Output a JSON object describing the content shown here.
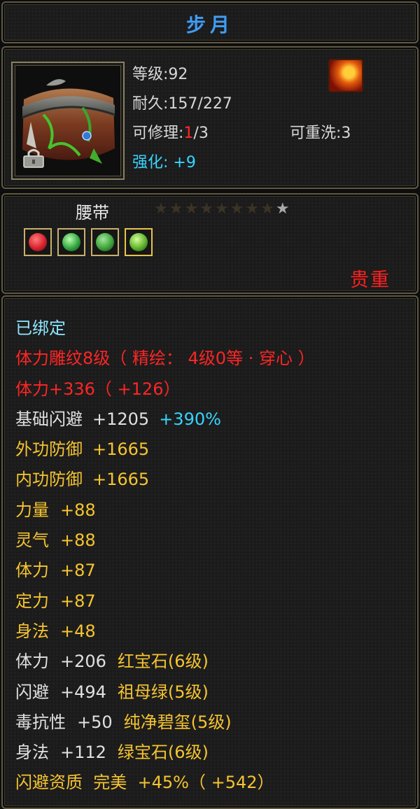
{
  "item": {
    "name": "步月",
    "level": "等级:92",
    "durability": "耐久:157/227",
    "repair_prefix": "可修理:",
    "repair_used": "1",
    "repair_total": "/3",
    "rewash": "可重洗:3",
    "strength_label": "强化:",
    "strength_value": "+9",
    "type": "腰带",
    "stars_total": 9,
    "stars_lit": 1,
    "rarity": "贵重"
  },
  "gems": [
    {
      "icon": "ruby-gem-icon",
      "color": "#d8222d"
    },
    {
      "icon": "emerald-gem-icon",
      "color": "#34a640"
    },
    {
      "icon": "jade-gem-icon",
      "color": "#3fa23a"
    },
    {
      "icon": "green-gem-icon",
      "color": "#5fb22d"
    }
  ],
  "attributes": {
    "bound": "已绑定",
    "engrave": "体力雕纹8级（ 精绘： 4级0等 · 穿心 ）",
    "stamina_main": "体力+336（ +126）",
    "dodge_base": {
      "label": "基础闪避",
      "value": "+1205",
      "extra": "+390%"
    },
    "outer_defense": {
      "label": "外功防御",
      "value": "+1665"
    },
    "inner_defense": {
      "label": "内功防御",
      "value": "+1665"
    },
    "power": {
      "label": "力量",
      "value": "+88"
    },
    "spirit": {
      "label": "灵气",
      "value": "+88"
    },
    "stamina": {
      "label": "体力",
      "value": "+87"
    },
    "focus": {
      "label": "定力",
      "value": "+87"
    },
    "agility": {
      "label": "身法",
      "value": "+48"
    },
    "gem_stamina": {
      "label": "体力",
      "value": "+206",
      "gem": "红宝石",
      "gem_level": "(6级)"
    },
    "gem_dodge": {
      "label": "闪避",
      "value": "+494",
      "gem": "祖母绿",
      "gem_level": "(5级)"
    },
    "gem_poison": {
      "label": "毒抗性",
      "value": "+50",
      "gem": "纯净碧玺",
      "gem_level": "(5级)"
    },
    "gem_agility": {
      "label": "身法",
      "value": "+112",
      "gem": "绿宝石",
      "gem_level": "(6级)"
    },
    "quality": "闪避资质  完美  +45%（ +542）"
  },
  "colors": {
    "title": "#3f9cf4",
    "rarity": "#ff2020",
    "strength": "#37d6ff",
    "attribute_yellow": "#f6c430",
    "attribute_red": "#ff2525"
  }
}
